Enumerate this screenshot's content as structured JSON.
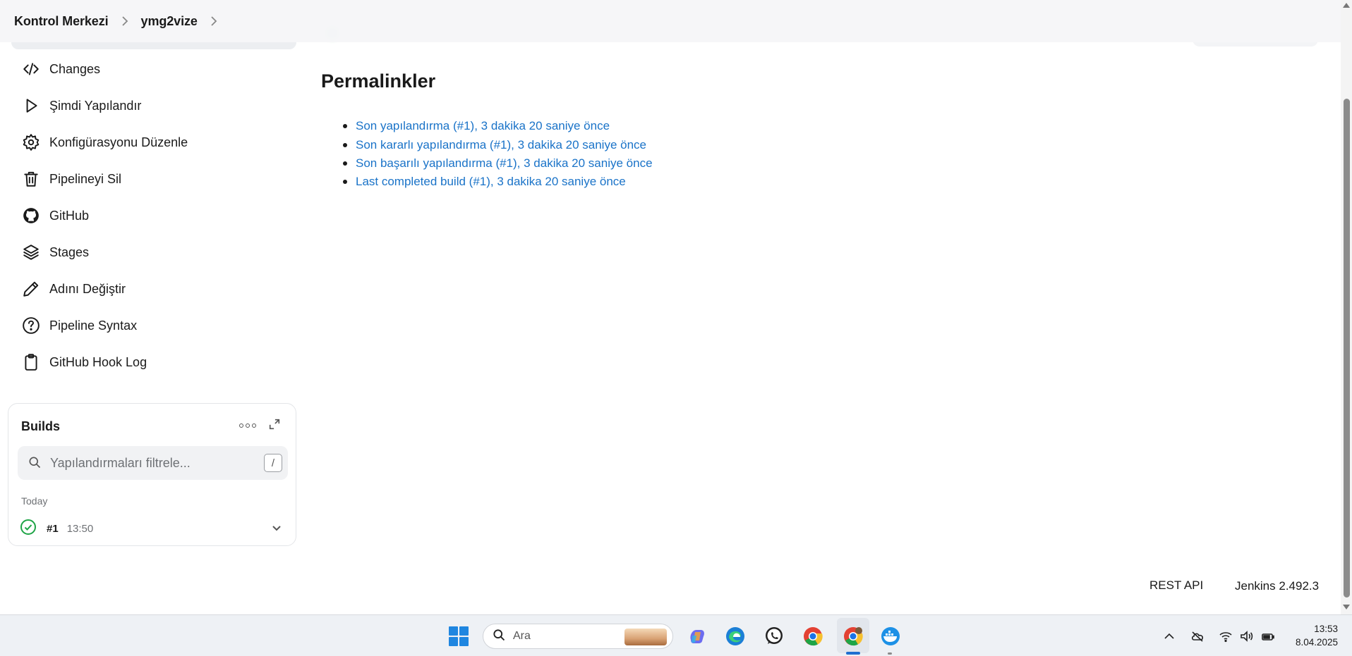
{
  "breadcrumb": {
    "items": [
      "Kontrol Merkezi",
      "ymg2vize"
    ]
  },
  "sidebar": {
    "tasks": [
      {
        "label": "Changes",
        "icon": "code-icon"
      },
      {
        "label": "Şimdi Yapılandır",
        "icon": "play-icon"
      },
      {
        "label": "Konfigürasyonu Düzenle",
        "icon": "gear-icon"
      },
      {
        "label": "Pipelineyi Sil",
        "icon": "trash-icon"
      },
      {
        "label": "GitHub",
        "icon": "github-icon"
      },
      {
        "label": "Stages",
        "icon": "layers-icon"
      },
      {
        "label": "Adını Değiştir",
        "icon": "pencil-icon"
      },
      {
        "label": "Pipeline Syntax",
        "icon": "help-circle-icon"
      },
      {
        "label": "GitHub Hook Log",
        "icon": "clipboard-icon"
      }
    ]
  },
  "builds": {
    "title": "Builds",
    "search_placeholder": "Yapılandırmaları filtrele...",
    "shortcut": "/",
    "group_label": "Today",
    "items": [
      {
        "number": "#1",
        "time": "13:50",
        "status": "success"
      }
    ]
  },
  "main": {
    "heading": "Permalinkler",
    "permalinks": [
      "Son yapılandırma (#1), 3 dakika 20 saniye önce",
      "Son kararlı yapılandırma (#1), 3 dakika 20 saniye önce",
      "Son başarılı yapılandırma (#1), 3 dakika 20 saniye önce",
      "Last completed build (#1), 3 dakika 20 saniye önce"
    ]
  },
  "footer": {
    "rest_api": "REST API",
    "version": "Jenkins 2.492.3"
  },
  "taskbar": {
    "search_label": "Ara",
    "time": "13:53",
    "date": "8.04.2025",
    "colors": {
      "accent": "#1f6fd0",
      "link": "#1a73c8",
      "success": "#1ea446"
    }
  }
}
